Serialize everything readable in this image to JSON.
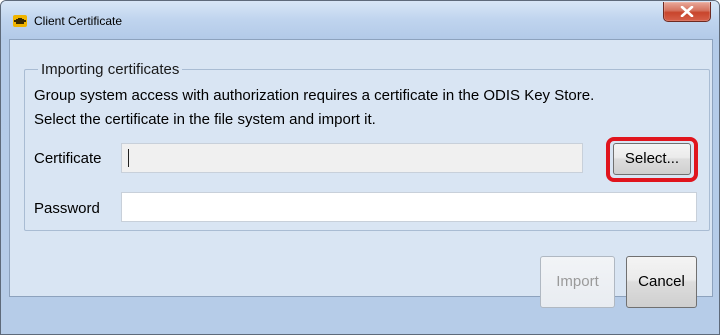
{
  "window": {
    "title": "Client Certificate",
    "app_icon": "car-engine-warning-icon",
    "close_icon": "close-icon"
  },
  "group": {
    "legend": "Importing certificates",
    "description_line1": "Group system access with authorization requires a certificate in the ODIS Key Store.",
    "description_line2": "Select the certificate in the file system and import it."
  },
  "fields": {
    "certificate_label": "Certificate",
    "certificate_value": "",
    "password_label": "Password",
    "password_value": ""
  },
  "buttons": {
    "select_label": "Select...",
    "import_label": "Import",
    "import_enabled": false,
    "cancel_label": "Cancel"
  },
  "colors": {
    "highlight": "#e0141d",
    "close_button": "#c8452c"
  }
}
